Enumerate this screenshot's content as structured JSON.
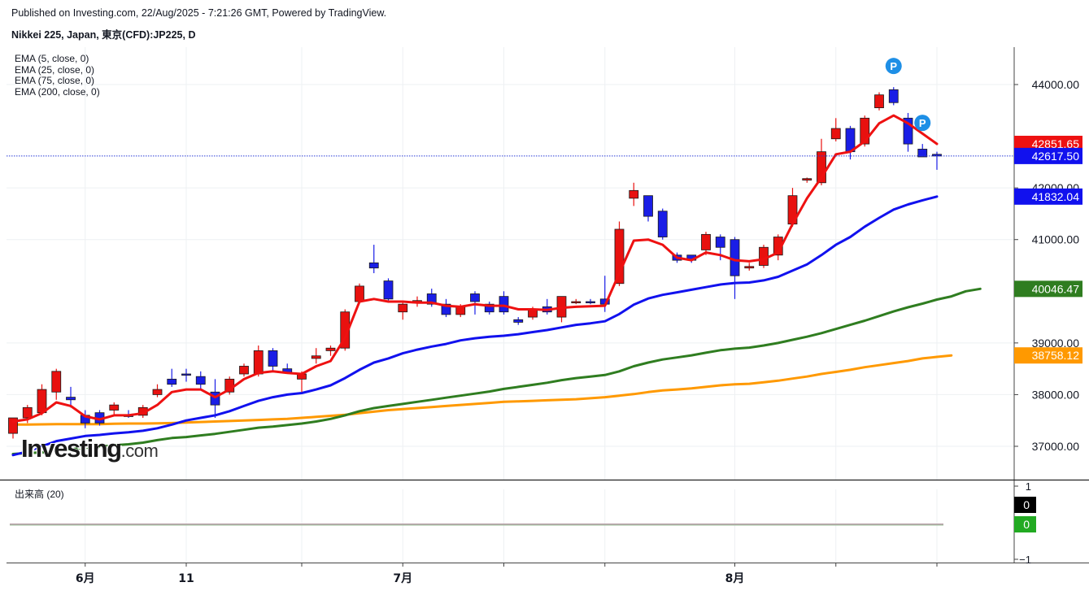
{
  "header": {
    "published": "Published on Investing.com, 22/Aug/2025 - 7:21:26 GMT, Powered by TradingView.",
    "instrument": "Nikkei 225, Japan, 東京(CFD):JP225, D"
  },
  "legend": {
    "ema_lines": [
      "EMA (5, close, 0)",
      "EMA (25, close, 0)",
      "EMA (75, close, 0)",
      "EMA (200, close, 0)"
    ],
    "volume": "出来高 (20)"
  },
  "logo": {
    "main": "Investing",
    "suffix": ".com"
  },
  "colors": {
    "up_candle": "#e8110f",
    "down_candle": "#1a1ee6",
    "ema5": "#ee1111",
    "ema25": "#1111ee",
    "ema75": "#2f7d20",
    "ema200": "#ff9900",
    "last_price_line": "#2a3bd6"
  },
  "chart_data": {
    "type": "candlestick",
    "title": "Nikkei 225, Japan, 東京(CFD):JP225, D",
    "ylim": [
      36400,
      44800
    ],
    "y_ticks": [
      {
        "value": 37000,
        "label": "37000.00"
      },
      {
        "value": 38000,
        "label": "38000.00"
      },
      {
        "value": 39000,
        "label": "39000.00"
      },
      {
        "value": 41000,
        "label": "41000.00"
      },
      {
        "value": 42000,
        "label": "42000.00"
      },
      {
        "value": 44000,
        "label": "44000.00"
      }
    ],
    "x_labels": [
      "6月",
      "11",
      "7月",
      "8月"
    ],
    "x_label_candle_index": [
      5,
      12,
      27,
      50
    ],
    "grid_candle_index": [
      5,
      12,
      20,
      27,
      34,
      41,
      50,
      57,
      64
    ],
    "candles": [
      {
        "o": 37250,
        "h": 37450,
        "l": 37150,
        "c": 37550
      },
      {
        "o": 37550,
        "h": 37800,
        "l": 37450,
        "c": 37750
      },
      {
        "o": 37650,
        "h": 38200,
        "l": 37600,
        "c": 38100
      },
      {
        "o": 38050,
        "h": 38500,
        "l": 37900,
        "c": 38450
      },
      {
        "o": 37950,
        "h": 38150,
        "l": 37750,
        "c": 37900
      },
      {
        "o": 37600,
        "h": 37700,
        "l": 37350,
        "c": 37450
      },
      {
        "o": 37650,
        "h": 37700,
        "l": 37400,
        "c": 37450
      },
      {
        "o": 37700,
        "h": 37850,
        "l": 37600,
        "c": 37800
      },
      {
        "o": 37600,
        "h": 37700,
        "l": 37550,
        "c": 37580
      },
      {
        "o": 37600,
        "h": 37800,
        "l": 37550,
        "c": 37750
      },
      {
        "o": 38000,
        "h": 38200,
        "l": 37950,
        "c": 38100
      },
      {
        "o": 38300,
        "h": 38500,
        "l": 38150,
        "c": 38200
      },
      {
        "o": 38400,
        "h": 38500,
        "l": 38250,
        "c": 38380
      },
      {
        "o": 38350,
        "h": 38450,
        "l": 38100,
        "c": 38200
      },
      {
        "o": 38050,
        "h": 38300,
        "l": 37550,
        "c": 37800
      },
      {
        "o": 38050,
        "h": 38350,
        "l": 38000,
        "c": 38300
      },
      {
        "o": 38400,
        "h": 38600,
        "l": 38350,
        "c": 38550
      },
      {
        "o": 38400,
        "h": 38950,
        "l": 38350,
        "c": 38850
      },
      {
        "o": 38850,
        "h": 38900,
        "l": 38450,
        "c": 38550
      },
      {
        "o": 38500,
        "h": 38600,
        "l": 38400,
        "c": 38420
      },
      {
        "o": 38300,
        "h": 38450,
        "l": 38050,
        "c": 38400
      },
      {
        "o": 38700,
        "h": 38900,
        "l": 38600,
        "c": 38750
      },
      {
        "o": 38850,
        "h": 38950,
        "l": 38750,
        "c": 38900
      },
      {
        "o": 38900,
        "h": 39650,
        "l": 38850,
        "c": 39600
      },
      {
        "o": 39800,
        "h": 40150,
        "l": 39750,
        "c": 40100
      },
      {
        "o": 40550,
        "h": 40900,
        "l": 40350,
        "c": 40450
      },
      {
        "o": 40200,
        "h": 40250,
        "l": 39800,
        "c": 39850
      },
      {
        "o": 39600,
        "h": 39800,
        "l": 39450,
        "c": 39750
      },
      {
        "o": 39800,
        "h": 39900,
        "l": 39700,
        "c": 39820
      },
      {
        "o": 39950,
        "h": 40050,
        "l": 39700,
        "c": 39750
      },
      {
        "o": 39750,
        "h": 39850,
        "l": 39500,
        "c": 39550
      },
      {
        "o": 39550,
        "h": 39750,
        "l": 39500,
        "c": 39700
      },
      {
        "o": 39950,
        "h": 40000,
        "l": 39550,
        "c": 39800
      },
      {
        "o": 39750,
        "h": 39800,
        "l": 39550,
        "c": 39600
      },
      {
        "o": 39900,
        "h": 40000,
        "l": 39550,
        "c": 39600
      },
      {
        "o": 39450,
        "h": 39500,
        "l": 39350,
        "c": 39400
      },
      {
        "o": 39500,
        "h": 39700,
        "l": 39450,
        "c": 39650
      },
      {
        "o": 39700,
        "h": 39850,
        "l": 39550,
        "c": 39600
      },
      {
        "o": 39500,
        "h": 39900,
        "l": 39400,
        "c": 39900
      },
      {
        "o": 39800,
        "h": 39850,
        "l": 39750,
        "c": 39800
      },
      {
        "o": 39800,
        "h": 39850,
        "l": 39750,
        "c": 39780
      },
      {
        "o": 39850,
        "h": 40300,
        "l": 39600,
        "c": 39750
      },
      {
        "o": 40150,
        "h": 41350,
        "l": 40100,
        "c": 41200
      },
      {
        "o": 41800,
        "h": 42100,
        "l": 41650,
        "c": 41950
      },
      {
        "o": 41850,
        "h": 41850,
        "l": 41350,
        "c": 41450
      },
      {
        "o": 41550,
        "h": 41600,
        "l": 41000,
        "c": 41050
      },
      {
        "o": 40700,
        "h": 40750,
        "l": 40550,
        "c": 40600
      },
      {
        "o": 40700,
        "h": 40700,
        "l": 40550,
        "c": 40600
      },
      {
        "o": 40800,
        "h": 41150,
        "l": 40700,
        "c": 41100
      },
      {
        "o": 41050,
        "h": 41100,
        "l": 40600,
        "c": 40850
      },
      {
        "o": 41000,
        "h": 41050,
        "l": 39850,
        "c": 40300
      },
      {
        "o": 40450,
        "h": 40550,
        "l": 40400,
        "c": 40480
      },
      {
        "o": 40500,
        "h": 40900,
        "l": 40450,
        "c": 40850
      },
      {
        "o": 40700,
        "h": 41100,
        "l": 40600,
        "c": 41050
      },
      {
        "o": 41300,
        "h": 42000,
        "l": 41250,
        "c": 41850
      },
      {
        "o": 42150,
        "h": 42200,
        "l": 42100,
        "c": 42180
      },
      {
        "o": 42100,
        "h": 42950,
        "l": 42050,
        "c": 42700
      },
      {
        "o": 42950,
        "h": 43350,
        "l": 42900,
        "c": 43150
      },
      {
        "o": 43150,
        "h": 43200,
        "l": 42550,
        "c": 42700
      },
      {
        "o": 42850,
        "h": 43400,
        "l": 42800,
        "c": 43350
      },
      {
        "o": 43550,
        "h": 43850,
        "l": 43500,
        "c": 43800
      },
      {
        "o": 43900,
        "h": 43950,
        "l": 43600,
        "c": 43650
      },
      {
        "o": 43350,
        "h": 43450,
        "l": 42700,
        "c": 42850
      },
      {
        "o": 42750,
        "h": 42850,
        "l": 42600,
        "c": 42600
      },
      {
        "o": 42650,
        "h": 42700,
        "l": 42350,
        "c": 42617.5
      }
    ],
    "series": [
      {
        "name": "EMA (5, close, 0)",
        "color": "#ee1111",
        "values": [
          37480,
          37520,
          37640,
          37850,
          37780,
          37580,
          37520,
          37600,
          37600,
          37640,
          37800,
          38050,
          38100,
          38100,
          37950,
          38100,
          38300,
          38420,
          38450,
          38420,
          38400,
          38550,
          38650,
          39100,
          39800,
          39850,
          39800,
          39800,
          39780,
          39780,
          39720,
          39700,
          39750,
          39720,
          39720,
          39650,
          39650,
          39640,
          39680,
          39700,
          39710,
          39720,
          40350,
          40980,
          41000,
          40900,
          40650,
          40600,
          40750,
          40700,
          40600,
          40580,
          40620,
          40750,
          41300,
          41800,
          42200,
          42650,
          42700,
          42900,
          43250,
          43400,
          43250,
          43050,
          42851.65
        ]
      },
      {
        "name": "EMA (25, close, 0)",
        "color": "#1111ee",
        "values": [
          36830,
          36900,
          37000,
          37100,
          37150,
          37200,
          37220,
          37250,
          37270,
          37300,
          37350,
          37420,
          37500,
          37550,
          37600,
          37680,
          37780,
          37880,
          37950,
          38000,
          38030,
          38100,
          38180,
          38320,
          38480,
          38620,
          38700,
          38800,
          38870,
          38930,
          38980,
          39050,
          39090,
          39120,
          39140,
          39170,
          39210,
          39250,
          39300,
          39350,
          39380,
          39420,
          39560,
          39740,
          39860,
          39930,
          39980,
          40030,
          40080,
          40130,
          40160,
          40170,
          40210,
          40280,
          40400,
          40520,
          40700,
          40900,
          41050,
          41250,
          41420,
          41580,
          41680,
          41760,
          41832.04
        ]
      },
      {
        "name": "EMA (75, close, 0)",
        "color": "#2f7d20",
        "values": [
          36850,
          36870,
          36880,
          36920,
          36950,
          36970,
          36990,
          37020,
          37040,
          37070,
          37120,
          37160,
          37180,
          37210,
          37240,
          37280,
          37320,
          37360,
          37380,
          37410,
          37440,
          37480,
          37530,
          37600,
          37680,
          37740,
          37780,
          37820,
          37860,
          37900,
          37940,
          37980,
          38020,
          38060,
          38110,
          38150,
          38190,
          38230,
          38280,
          38320,
          38350,
          38380,
          38450,
          38550,
          38620,
          38680,
          38720,
          38760,
          38810,
          38860,
          38890,
          38910,
          38950,
          39000,
          39060,
          39120,
          39190,
          39270,
          39350,
          39430,
          39520,
          39610,
          39690,
          39760,
          39840,
          39900,
          40000,
          40046.47
        ]
      },
      {
        "name": "EMA (200, close, 0)",
        "color": "#ff9900",
        "values": [
          37420,
          37420,
          37425,
          37430,
          37430,
          37430,
          37430,
          37435,
          37440,
          37440,
          37445,
          37450,
          37460,
          37470,
          37480,
          37490,
          37500,
          37510,
          37520,
          37530,
          37550,
          37570,
          37590,
          37610,
          37640,
          37670,
          37700,
          37720,
          37740,
          37760,
          37780,
          37800,
          37820,
          37840,
          37860,
          37870,
          37880,
          37890,
          37900,
          37910,
          37930,
          37950,
          37980,
          38010,
          38050,
          38080,
          38100,
          38120,
          38150,
          38180,
          38200,
          38210,
          38240,
          38270,
          38310,
          38350,
          38400,
          38440,
          38480,
          38530,
          38570,
          38610,
          38650,
          38700,
          38730,
          38758.12
        ]
      }
    ],
    "right_labels": [
      {
        "value": 42851.65,
        "label": "42851.65",
        "color": "#ee1111"
      },
      {
        "value": 42617.5,
        "label": "42617.50",
        "color": "#1111ee"
      },
      {
        "value": 41832.04,
        "label": "41832.04",
        "color": "#1111ee"
      },
      {
        "value": 40046.47,
        "label": "40046.47",
        "color": "#2f7d20"
      },
      {
        "value": 38758.12,
        "label": "38758.12",
        "color": "#ff9900"
      }
    ],
    "pivot_markers": [
      {
        "candle_index": 61,
        "label": "P"
      },
      {
        "candle_index": 63,
        "label": "P"
      }
    ],
    "volume_panel": {
      "name": "出来高 (20)",
      "y_ticks": [
        {
          "value": 1,
          "label": "1"
        },
        {
          "value": -1,
          "label": "−1"
        }
      ],
      "right_labels": [
        {
          "value": 0,
          "label": "0",
          "color": "#000000"
        },
        {
          "value": 0,
          "label": "0",
          "color": "#22aa22"
        }
      ]
    }
  }
}
